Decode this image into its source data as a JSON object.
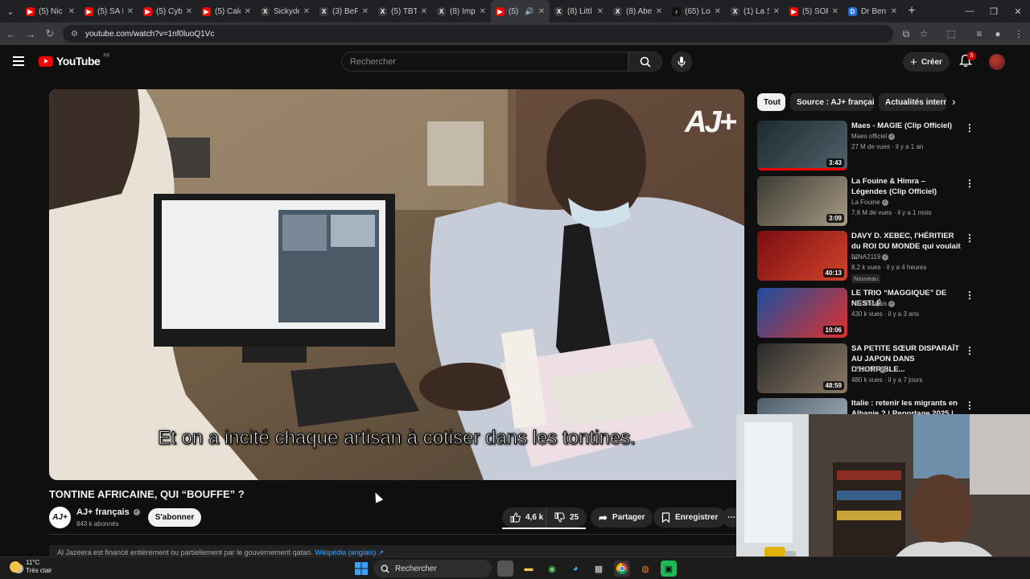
{
  "browser": {
    "tabs": [
      {
        "title": "(5) Nic",
        "fav_color": "#ff0000",
        "fav_glyph": "▶"
      },
      {
        "title": "(5) SA F",
        "fav_color": "#ff0000",
        "fav_glyph": "▶"
      },
      {
        "title": "(5) Cyb",
        "fav_color": "#ff0000",
        "fav_glyph": "▶"
      },
      {
        "title": "(5) Calc",
        "fav_color": "#ff0000",
        "fav_glyph": "▶"
      },
      {
        "title": "Sickyde",
        "fav_color": "#3a3a3a",
        "fav_glyph": "X"
      },
      {
        "title": "(3) BeF",
        "fav_color": "#3a3a3a",
        "fav_glyph": "X"
      },
      {
        "title": "(5) TBT",
        "fav_color": "#3a3a3a",
        "fav_glyph": "X"
      },
      {
        "title": "(8) Imp",
        "fav_color": "#3a3a3a",
        "fav_glyph": "X"
      },
      {
        "title": "(5)",
        "fav_color": "#ff0000",
        "fav_glyph": "▶",
        "active": true
      },
      {
        "title": "(8) Littl",
        "fav_color": "#3a3a3a",
        "fav_glyph": "X"
      },
      {
        "title": "(8) Abe",
        "fav_color": "#3a3a3a",
        "fav_glyph": "X"
      },
      {
        "title": "(65) Lou",
        "fav_color": "#111111",
        "fav_glyph": "♪"
      },
      {
        "title": "(1) La S",
        "fav_color": "#3a3a3a",
        "fav_glyph": "X"
      },
      {
        "title": "(5) SOF",
        "fav_color": "#ff0000",
        "fav_glyph": "▶"
      },
      {
        "title": "Dr Ben",
        "fav_color": "#1a73e8",
        "fav_glyph": "D"
      }
    ],
    "url": "youtube.com/watch?v=1nf0luoQ1Vc"
  },
  "youtube": {
    "logo_text": "YouTube",
    "country_code": "FR",
    "search_placeholder": "Rechercher",
    "create_label": "Créer",
    "notification_count": "5"
  },
  "player": {
    "subtitle": "Et on a incité chaque artisan à cotiser dans les tontines.",
    "watermark": "AJ+"
  },
  "video": {
    "title": "TONTINE AFRICAINE, QUI “BOUFFE” ?",
    "channel_name": "AJ+ français",
    "channel_subs": "843 k abonnés",
    "subscribe_label": "S'abonner",
    "likes": "4,6 k",
    "dislikes": "25",
    "share_label": "Partager",
    "save_label": "Enregistrer",
    "more_label": "⋯",
    "info_text": "Al Jazeera est financé entièrement ou partiellement par le gouvernement qatari.",
    "info_link": "Wikipédia (anglais) ↗"
  },
  "chips": [
    "Tout",
    "Source : AJ+ français",
    "Actualités internationales"
  ],
  "recommendations": [
    {
      "title": "Maes - MAGIE (Clip Officiel)",
      "channel": "Maes officiel",
      "verified": true,
      "meta": "27 M de vues · il y a 1 an",
      "duration": "3:43",
      "watched": true,
      "thumb_colors": [
        "#1d2b2f",
        "#51616a"
      ]
    },
    {
      "title": "La Fouine & Himra – Légendes (Clip Officiel)",
      "channel": "La Fouine",
      "verified": true,
      "meta": "7,8 M de vues · il y a 1 mois",
      "duration": "3:09",
      "watched": false,
      "thumb_colors": [
        "#3c3a33",
        "#a69a84"
      ]
    },
    {
      "title": "DAVY D. XEBEC, l'HÉRITIER du ROI DU MONDE qui voulait ...",
      "channel": "NINA2119",
      "verified": true,
      "meta": "8,2 k vues · il y a 4 heures",
      "badge": "Nouveau",
      "duration": "40:13",
      "watched": false,
      "thumb_colors": [
        "#7a0d12",
        "#d2432a"
      ]
    },
    {
      "title": "LE TRIO “MAGGIQUE” DE NESTLÉ",
      "channel": "AJ+ français",
      "verified": true,
      "meta": "430 k vues · il y a 3 ans",
      "duration": "10:06",
      "watched": false,
      "thumb_colors": [
        "#1a4fa0",
        "#e0312c"
      ]
    },
    {
      "title": "SA PETITE SŒUR DISPARAÎT AU JAPON DANS D'HORRIBLE...",
      "channel": "LEGEND",
      "verified": true,
      "meta": "480 k vues · il y a 7 jours",
      "duration": "48:59",
      "watched": false,
      "thumb_colors": [
        "#2a2a2a",
        "#8b7a66"
      ]
    },
    {
      "title": "Italie : retenir les migrants en Albanie ? | Reportage 2025 |...",
      "channel": "",
      "verified": false,
      "meta": "",
      "duration": "",
      "watched": false,
      "thumb_colors": [
        "#4f5e6b",
        "#a9b4bd"
      ]
    }
  ],
  "taskbar": {
    "temperature": "11°C",
    "weather": "Très clair",
    "search_label": "Rechercher"
  }
}
